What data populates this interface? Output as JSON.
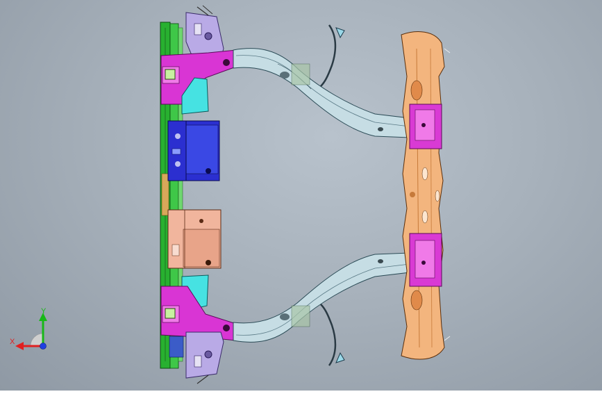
{
  "viewport": {
    "colors": {
      "green": "#27b02f",
      "magenta": "#d42ad0",
      "cyan": "#3fe0e0",
      "blue": "#2a2ec8",
      "salmon": "#f0b49a",
      "orange": "#f0b07a",
      "lavender": "#b7a8e0",
      "steel": "#b9d3dc"
    }
  },
  "triad": {
    "x_label": "X",
    "y_label": "Y",
    "x_color": "#e02020",
    "y_color": "#18b818",
    "z_color": "#2040e0"
  }
}
